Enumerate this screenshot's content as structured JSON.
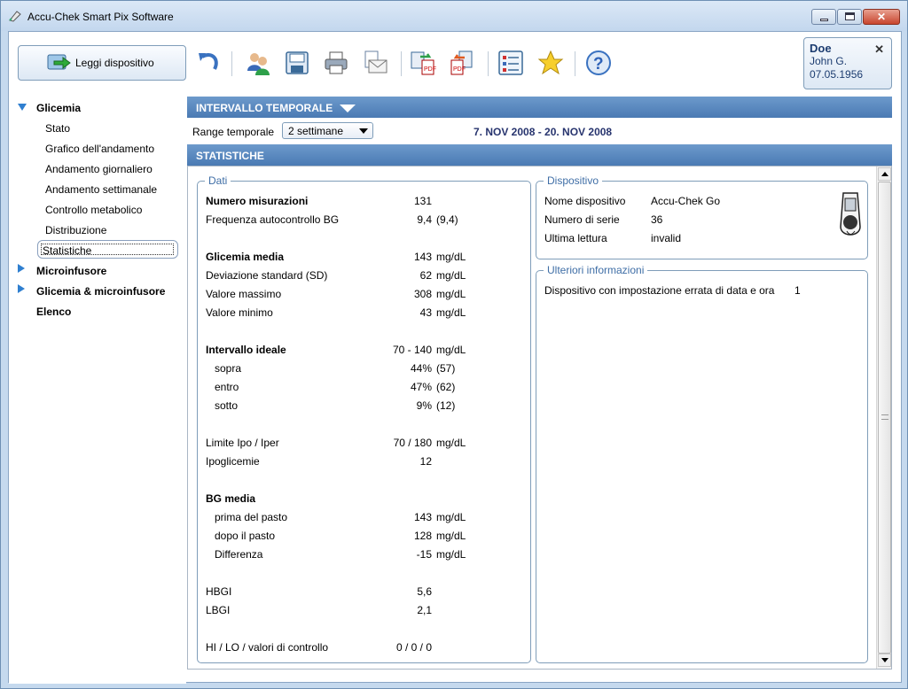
{
  "window": {
    "title": "Accu-Chek Smart Pix Software"
  },
  "toolbar": {
    "read_device": "Leggi dispositivo"
  },
  "patient": {
    "last_name": "Doe",
    "first_name": "John G.",
    "dob": "07.05.1956",
    "close": "✕"
  },
  "nav": {
    "glicemia": "Glicemia",
    "children": [
      "Stato",
      "Grafico dell'andamento",
      "Andamento giornaliero",
      "Andamento settimanale",
      "Controllo metabolico",
      "Distribuzione",
      "Statistiche"
    ],
    "microinfusore": "Microinfusore",
    "glicemia_micro": "Glicemia & microinfusore",
    "elenco": "Elenco"
  },
  "interval": {
    "header": "INTERVALLO TEMPORALE",
    "range_label": "Range temporale",
    "range_value": "2 settimane",
    "dates": "7. NOV 2008 - 20. NOV 2008"
  },
  "stats": {
    "header": "STATISTICHE",
    "dati_legend": "Dati",
    "rows": {
      "num_mis": {
        "label": "Numero misurazioni",
        "value": "131",
        "unit": ""
      },
      "freq": {
        "label": "Frequenza autocontrollo BG",
        "value": "9,4",
        "unit": "(9,4)"
      },
      "gl_media": {
        "label": "Glicemia media",
        "value": "143",
        "unit": "mg/dL"
      },
      "sd": {
        "label": "Deviazione standard (SD)",
        "value": "62",
        "unit": "mg/dL"
      },
      "max": {
        "label": "Valore massimo",
        "value": "308",
        "unit": "mg/dL"
      },
      "min": {
        "label": "Valore minimo",
        "value": "43",
        "unit": "mg/dL"
      },
      "ideale": {
        "label": "Intervallo ideale",
        "value": "70 - 140",
        "unit": "mg/dL"
      },
      "sopra": {
        "label": "sopra",
        "value": "44%",
        "unit": "(57)"
      },
      "entro": {
        "label": "entro",
        "value": "47%",
        "unit": "(62)"
      },
      "sotto": {
        "label": "sotto",
        "value": "9%",
        "unit": "(12)"
      },
      "limite": {
        "label": "Limite Ipo / Iper",
        "value": "70 / 180",
        "unit": "mg/dL"
      },
      "ipo": {
        "label": "Ipoglicemie",
        "value": "12",
        "unit": ""
      },
      "bg_media": {
        "label": "BG media",
        "value": "",
        "unit": ""
      },
      "prima": {
        "label": "prima del pasto",
        "value": "143",
        "unit": "mg/dL"
      },
      "dopo": {
        "label": "dopo il pasto",
        "value": "128",
        "unit": "mg/dL"
      },
      "diff": {
        "label": "Differenza",
        "value": "-15",
        "unit": "mg/dL"
      },
      "hbgi": {
        "label": "HBGI",
        "value": "5,6",
        "unit": ""
      },
      "lbgi": {
        "label": "LBGI",
        "value": "2,1",
        "unit": ""
      },
      "hilo": {
        "label": "HI / LO / valori di controllo",
        "value": "0 / 0 / 0",
        "unit": ""
      }
    }
  },
  "device": {
    "legend": "Dispositivo",
    "name_label": "Nome dispositivo",
    "name_value": "Accu-Chek Go",
    "serial_label": "Numero di serie",
    "serial_value": "36",
    "last_label": "Ultima lettura",
    "last_value": "invalid"
  },
  "more_info": {
    "legend": "Ulteriori informazioni",
    "label": "Dispositivo con impostazione errata di data e ora",
    "value": "1"
  },
  "icons": [
    "read-device-icon",
    "undo-icon",
    "patients-icon",
    "save-icon",
    "print-icon",
    "email-icon",
    "export-pdf-icon",
    "export-pdf-alt-icon",
    "report-list-icon",
    "favorite-star-icon",
    "help-icon",
    "meter-device-icon"
  ]
}
